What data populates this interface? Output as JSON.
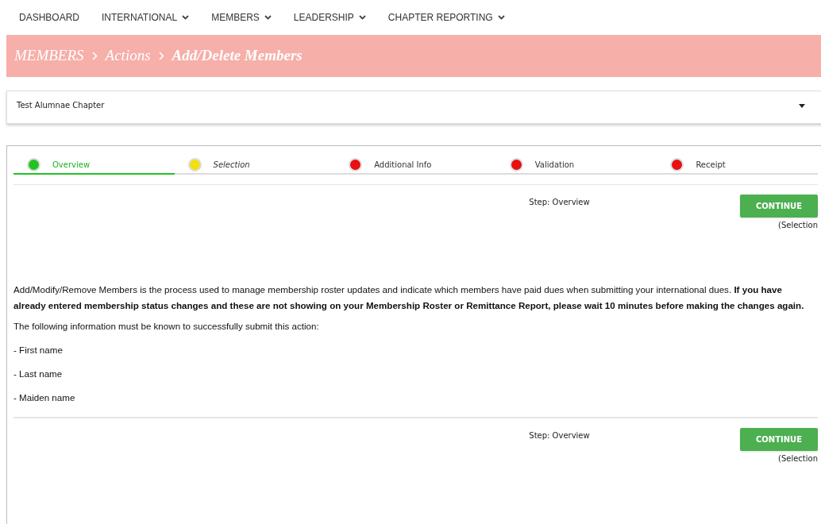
{
  "nav": [
    {
      "label": "DASHBOARD",
      "has_menu": false
    },
    {
      "label": "INTERNATIONAL",
      "has_menu": true
    },
    {
      "label": "MEMBERS",
      "has_menu": true
    },
    {
      "label": "LEADERSHIP",
      "has_menu": true
    },
    {
      "label": "CHAPTER REPORTING",
      "has_menu": true
    }
  ],
  "breadcrumb": [
    {
      "label": "MEMBERS",
      "current": false
    },
    {
      "label": "Actions",
      "current": false
    },
    {
      "label": "Add/Delete Members",
      "current": true
    }
  ],
  "chapter_select": {
    "value": "Test Alumnae Chapter"
  },
  "steps": [
    {
      "label": "Overview",
      "selected": true,
      "color": "#22c322",
      "emphasized": false
    },
    {
      "label": "Selection",
      "selected": false,
      "color": "#f0e010",
      "emphasized": true
    },
    {
      "label": "Additional Info",
      "selected": false,
      "color": "#e81010",
      "emphasized": false
    },
    {
      "label": "Validation",
      "selected": false,
      "color": "#e81010",
      "emphasized": false
    },
    {
      "label": "Receipt",
      "selected": false,
      "color": "#e81010",
      "emphasized": false
    }
  ],
  "top_bar": {
    "step": "Step: Overview",
    "button": "CONTINUE",
    "next": "(Selection"
  },
  "intro": "Add/Modify/Remove Members is the process used to manage membership roster updates and indicate which members have paid dues when submitting your international dues. **If you have already entered membership status changes and these are not showing on your Membership Roster or Remittance Report, please wait 10 minutes before making the changes again.**",
  "requirements_intro": "The following information must be known to successfully submit this action:",
  "requirements": [
    "- First name",
    "- Last name",
    "- Maiden name"
  ],
  "bottom_bar": {
    "step": "Step: Overview",
    "button": "CONTINUE",
    "next": "(Selection"
  }
}
